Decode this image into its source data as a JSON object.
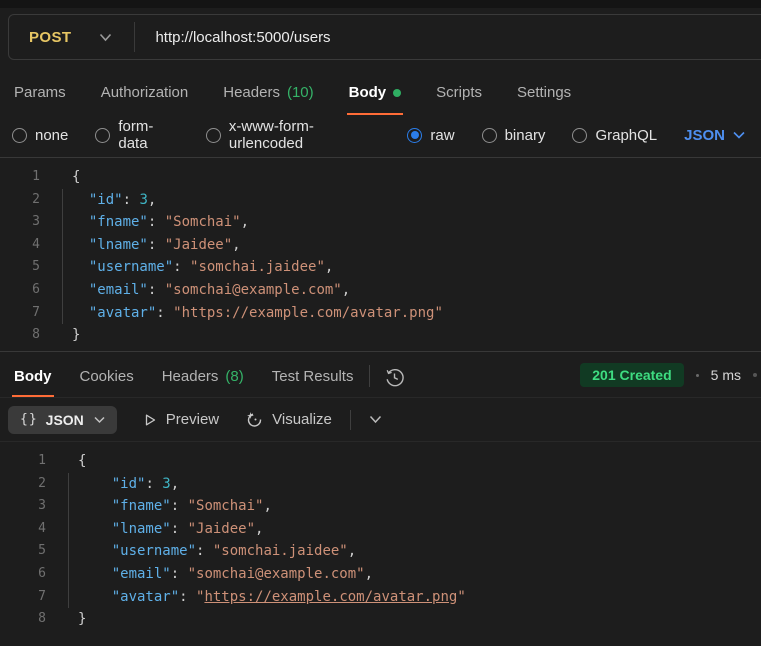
{
  "request": {
    "method": "POST",
    "url": "http://localhost:5000/users",
    "tabs": [
      {
        "label": "Params"
      },
      {
        "label": "Authorization"
      },
      {
        "label": "Headers",
        "count": "(10)"
      },
      {
        "label": "Body",
        "active": true,
        "dot": true
      },
      {
        "label": "Scripts"
      },
      {
        "label": "Settings"
      }
    ],
    "body_type_options": [
      {
        "label": "none"
      },
      {
        "label": "form-data"
      },
      {
        "label": "x-www-form-urlencoded"
      },
      {
        "label": "raw",
        "selected": true
      },
      {
        "label": "binary"
      },
      {
        "label": "GraphQL"
      }
    ],
    "raw_format": "JSON",
    "editor_lines": [
      [
        [
          "p",
          "{"
        ]
      ],
      [
        [
          "p",
          "  "
        ],
        [
          "k",
          "\"id\""
        ],
        [
          "p",
          ": "
        ],
        [
          "n",
          "3"
        ],
        [
          "p",
          ","
        ]
      ],
      [
        [
          "p",
          "  "
        ],
        [
          "k",
          "\"fname\""
        ],
        [
          "p",
          ": "
        ],
        [
          "s",
          "\"Somchai\""
        ],
        [
          "p",
          ","
        ]
      ],
      [
        [
          "p",
          "  "
        ],
        [
          "k",
          "\"lname\""
        ],
        [
          "p",
          ": "
        ],
        [
          "s",
          "\"Jaidee\""
        ],
        [
          "p",
          ","
        ]
      ],
      [
        [
          "p",
          "  "
        ],
        [
          "k",
          "\"username\""
        ],
        [
          "p",
          ": "
        ],
        [
          "s",
          "\"somchai.jaidee\""
        ],
        [
          "p",
          ","
        ]
      ],
      [
        [
          "p",
          "  "
        ],
        [
          "k",
          "\"email\""
        ],
        [
          "p",
          ": "
        ],
        [
          "s",
          "\"somchai@example.com\""
        ],
        [
          "p",
          ","
        ]
      ],
      [
        [
          "p",
          "  "
        ],
        [
          "k",
          "\"avatar\""
        ],
        [
          "p",
          ": "
        ],
        [
          "s",
          "\"https://example.com/avatar.png\""
        ]
      ],
      [
        [
          "p",
          "}"
        ]
      ]
    ]
  },
  "response": {
    "tabs": [
      {
        "label": "Body",
        "active": true
      },
      {
        "label": "Cookies"
      },
      {
        "label": "Headers",
        "count": "(8)"
      },
      {
        "label": "Test Results"
      }
    ],
    "status": "201 Created",
    "time": "5 ms",
    "toolbar": {
      "format_icon": "{}",
      "format": "JSON",
      "preview": "Preview",
      "visualize": "Visualize"
    },
    "editor_lines": [
      [
        [
          "p",
          "{"
        ]
      ],
      [
        [
          "p",
          "    "
        ],
        [
          "k",
          "\"id\""
        ],
        [
          "p",
          ": "
        ],
        [
          "n",
          "3"
        ],
        [
          "p",
          ","
        ]
      ],
      [
        [
          "p",
          "    "
        ],
        [
          "k",
          "\"fname\""
        ],
        [
          "p",
          ": "
        ],
        [
          "s",
          "\"Somchai\""
        ],
        [
          "p",
          ","
        ]
      ],
      [
        [
          "p",
          "    "
        ],
        [
          "k",
          "\"lname\""
        ],
        [
          "p",
          ": "
        ],
        [
          "s",
          "\"Jaidee\""
        ],
        [
          "p",
          ","
        ]
      ],
      [
        [
          "p",
          "    "
        ],
        [
          "k",
          "\"username\""
        ],
        [
          "p",
          ": "
        ],
        [
          "s",
          "\"somchai.jaidee\""
        ],
        [
          "p",
          ","
        ]
      ],
      [
        [
          "p",
          "    "
        ],
        [
          "k",
          "\"email\""
        ],
        [
          "p",
          ": "
        ],
        [
          "s",
          "\"somchai@example.com\""
        ],
        [
          "p",
          ","
        ]
      ],
      [
        [
          "p",
          "    "
        ],
        [
          "k",
          "\"avatar\""
        ],
        [
          "p",
          ": "
        ],
        [
          "s",
          "\""
        ],
        [
          "u",
          "https://example.com/avatar.png"
        ],
        [
          "s",
          "\""
        ]
      ],
      [
        [
          "p",
          "}"
        ]
      ]
    ]
  },
  "colors": {
    "accent_orange": "#ff6c37",
    "success_green": "#2fae62",
    "count_green": "#35b368",
    "selected_radio_blue": "#2b7de9",
    "format_link_blue": "#4e8ff0",
    "method_post_yellow": "#e7c664",
    "status_badge_text": "#3edc81",
    "status_badge_bg": "#113a23",
    "code_key": "#5fb0e8",
    "code_string": "#ce9178",
    "code_number": "#3fb6c6"
  }
}
